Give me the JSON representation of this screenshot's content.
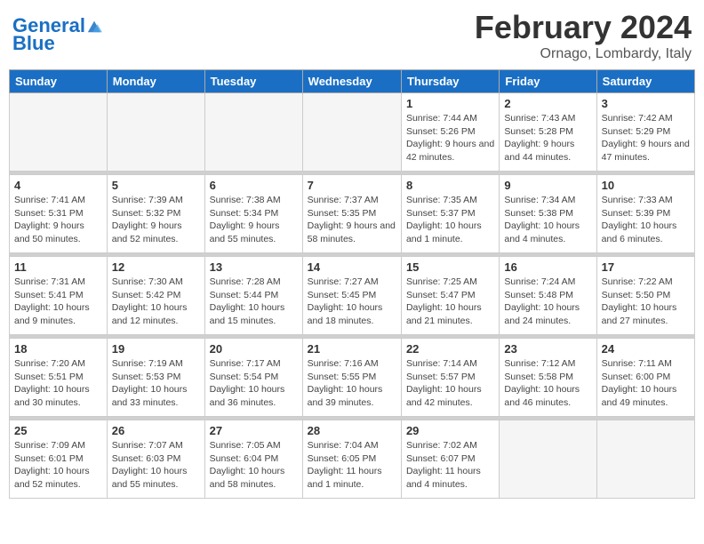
{
  "logo": {
    "line1": "General",
    "line2": "Blue"
  },
  "title": "February 2024",
  "location": "Ornago, Lombardy, Italy",
  "weekdays": [
    "Sunday",
    "Monday",
    "Tuesday",
    "Wednesday",
    "Thursday",
    "Friday",
    "Saturday"
  ],
  "weeks": [
    [
      {
        "day": "",
        "info": ""
      },
      {
        "day": "",
        "info": ""
      },
      {
        "day": "",
        "info": ""
      },
      {
        "day": "",
        "info": ""
      },
      {
        "day": "1",
        "info": "Sunrise: 7:44 AM\nSunset: 5:26 PM\nDaylight: 9 hours\nand 42 minutes."
      },
      {
        "day": "2",
        "info": "Sunrise: 7:43 AM\nSunset: 5:28 PM\nDaylight: 9 hours\nand 44 minutes."
      },
      {
        "day": "3",
        "info": "Sunrise: 7:42 AM\nSunset: 5:29 PM\nDaylight: 9 hours\nand 47 minutes."
      }
    ],
    [
      {
        "day": "4",
        "info": "Sunrise: 7:41 AM\nSunset: 5:31 PM\nDaylight: 9 hours\nand 50 minutes."
      },
      {
        "day": "5",
        "info": "Sunrise: 7:39 AM\nSunset: 5:32 PM\nDaylight: 9 hours\nand 52 minutes."
      },
      {
        "day": "6",
        "info": "Sunrise: 7:38 AM\nSunset: 5:34 PM\nDaylight: 9 hours\nand 55 minutes."
      },
      {
        "day": "7",
        "info": "Sunrise: 7:37 AM\nSunset: 5:35 PM\nDaylight: 9 hours\nand 58 minutes."
      },
      {
        "day": "8",
        "info": "Sunrise: 7:35 AM\nSunset: 5:37 PM\nDaylight: 10 hours\nand 1 minute."
      },
      {
        "day": "9",
        "info": "Sunrise: 7:34 AM\nSunset: 5:38 PM\nDaylight: 10 hours\nand 4 minutes."
      },
      {
        "day": "10",
        "info": "Sunrise: 7:33 AM\nSunset: 5:39 PM\nDaylight: 10 hours\nand 6 minutes."
      }
    ],
    [
      {
        "day": "11",
        "info": "Sunrise: 7:31 AM\nSunset: 5:41 PM\nDaylight: 10 hours\nand 9 minutes."
      },
      {
        "day": "12",
        "info": "Sunrise: 7:30 AM\nSunset: 5:42 PM\nDaylight: 10 hours\nand 12 minutes."
      },
      {
        "day": "13",
        "info": "Sunrise: 7:28 AM\nSunset: 5:44 PM\nDaylight: 10 hours\nand 15 minutes."
      },
      {
        "day": "14",
        "info": "Sunrise: 7:27 AM\nSunset: 5:45 PM\nDaylight: 10 hours\nand 18 minutes."
      },
      {
        "day": "15",
        "info": "Sunrise: 7:25 AM\nSunset: 5:47 PM\nDaylight: 10 hours\nand 21 minutes."
      },
      {
        "day": "16",
        "info": "Sunrise: 7:24 AM\nSunset: 5:48 PM\nDaylight: 10 hours\nand 24 minutes."
      },
      {
        "day": "17",
        "info": "Sunrise: 7:22 AM\nSunset: 5:50 PM\nDaylight: 10 hours\nand 27 minutes."
      }
    ],
    [
      {
        "day": "18",
        "info": "Sunrise: 7:20 AM\nSunset: 5:51 PM\nDaylight: 10 hours\nand 30 minutes."
      },
      {
        "day": "19",
        "info": "Sunrise: 7:19 AM\nSunset: 5:53 PM\nDaylight: 10 hours\nand 33 minutes."
      },
      {
        "day": "20",
        "info": "Sunrise: 7:17 AM\nSunset: 5:54 PM\nDaylight: 10 hours\nand 36 minutes."
      },
      {
        "day": "21",
        "info": "Sunrise: 7:16 AM\nSunset: 5:55 PM\nDaylight: 10 hours\nand 39 minutes."
      },
      {
        "day": "22",
        "info": "Sunrise: 7:14 AM\nSunset: 5:57 PM\nDaylight: 10 hours\nand 42 minutes."
      },
      {
        "day": "23",
        "info": "Sunrise: 7:12 AM\nSunset: 5:58 PM\nDaylight: 10 hours\nand 46 minutes."
      },
      {
        "day": "24",
        "info": "Sunrise: 7:11 AM\nSunset: 6:00 PM\nDaylight: 10 hours\nand 49 minutes."
      }
    ],
    [
      {
        "day": "25",
        "info": "Sunrise: 7:09 AM\nSunset: 6:01 PM\nDaylight: 10 hours\nand 52 minutes."
      },
      {
        "day": "26",
        "info": "Sunrise: 7:07 AM\nSunset: 6:03 PM\nDaylight: 10 hours\nand 55 minutes."
      },
      {
        "day": "27",
        "info": "Sunrise: 7:05 AM\nSunset: 6:04 PM\nDaylight: 10 hours\nand 58 minutes."
      },
      {
        "day": "28",
        "info": "Sunrise: 7:04 AM\nSunset: 6:05 PM\nDaylight: 11 hours\nand 1 minute."
      },
      {
        "day": "29",
        "info": "Sunrise: 7:02 AM\nSunset: 6:07 PM\nDaylight: 11 hours\nand 4 minutes."
      },
      {
        "day": "",
        "info": ""
      },
      {
        "day": "",
        "info": ""
      }
    ]
  ]
}
